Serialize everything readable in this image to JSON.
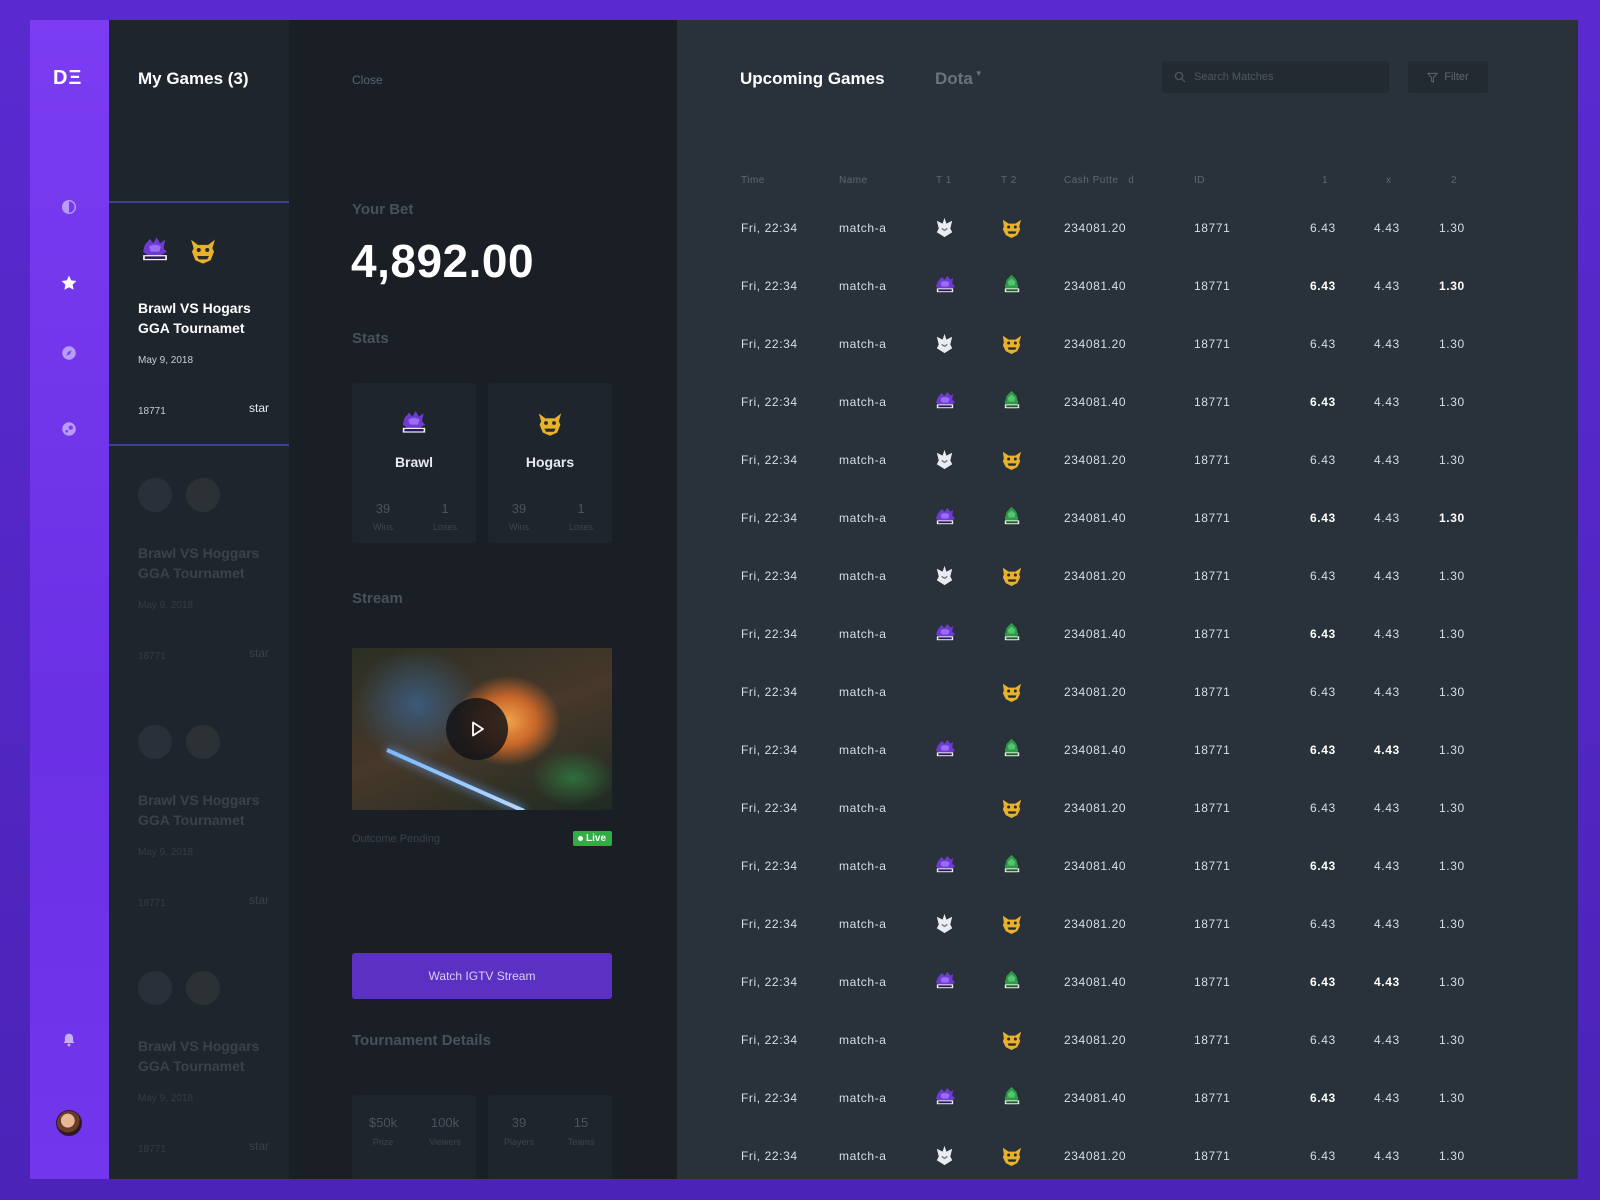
{
  "app": {
    "logo": "DΞ"
  },
  "nav": {
    "icons": [
      "half-circle-icon",
      "star-icon",
      "compass-icon",
      "steam-icon",
      "bell-icon"
    ]
  },
  "my_games": {
    "title": "My Games (3)",
    "active": {
      "team1_logo": "brawl-logo",
      "team2_logo": "hogars-logo",
      "title": "Brawl VS Hogars GGA Tournamet",
      "date": "May 9, 2018",
      "id": "18771",
      "star_label": "star"
    },
    "faded": [
      {
        "title": "Brawl VS Hoggars GGA Tournamet",
        "date": "May 9, 2018",
        "id": "18771",
        "star_label": "star"
      },
      {
        "title": "Brawl VS Hoggars GGA Tournamet",
        "date": "May 9, 2018",
        "id": "18771",
        "star_label": "star"
      },
      {
        "title": "Brawl VS Hoggars GGA Tournamet",
        "date": "May 9, 2018",
        "id": "18771",
        "star_label": "star"
      }
    ]
  },
  "detail": {
    "close_label": "Close",
    "bet_label": "Your Bet",
    "bet_amount": "4,892.00",
    "stats_label": "Stats",
    "teams": [
      {
        "name": "Brawl",
        "logo": "brawl-logo",
        "wins": "39",
        "wins_label": "Wins",
        "loses": "1",
        "loses_label": "Loses"
      },
      {
        "name": "Hogars",
        "logo": "hogars-logo",
        "wins": "39",
        "wins_label": "Wins",
        "loses": "1",
        "loses_label": "Loses"
      }
    ],
    "stream_label": "Stream",
    "outcome_label": "Outcome Pending",
    "live_label": "Live",
    "watch_button": "Watch IGTV Stream",
    "tournament_label": "Tournament Details",
    "tournament": [
      {
        "v1": "$50k",
        "l1": "Prize",
        "v2": "100k",
        "l2": "Viewers"
      },
      {
        "v1": "39",
        "l1": "Players",
        "v2": "15",
        "l2": "Teams"
      }
    ]
  },
  "upcoming": {
    "title": "Upcoming Games",
    "game_select": "Dota",
    "search_placeholder": "Search Matches",
    "filter_label": "Filter",
    "columns": [
      "Time",
      "Name",
      "T 1",
      "T 2",
      "Cash Putte   d",
      "ID",
      "1",
      "x",
      "2"
    ],
    "rows": [
      {
        "time": "Fri, 22:34",
        "name": "match-a",
        "t1": "wolf-logo",
        "t2": "hogars-logo",
        "cash": "234081.20",
        "id": "18771",
        "o1": "6.43",
        "ox": "4.43",
        "o2": "1.30",
        "b1": false,
        "bx": false,
        "b2": false
      },
      {
        "time": "Fri, 22:34",
        "name": "match-a",
        "t1": "brawl-logo",
        "t2": "ace-logo",
        "cash": "234081.40",
        "id": "18771",
        "o1": "6.43",
        "ox": "4.43",
        "o2": "1.30",
        "b1": true,
        "bx": false,
        "b2": true
      },
      {
        "time": "Fri, 22:34",
        "name": "match-a",
        "t1": "wolf-logo",
        "t2": "hogars-logo",
        "cash": "234081.20",
        "id": "18771",
        "o1": "6.43",
        "ox": "4.43",
        "o2": "1.30",
        "b1": false,
        "bx": false,
        "b2": false
      },
      {
        "time": "Fri, 22:34",
        "name": "match-a",
        "t1": "brawl-logo",
        "t2": "ace-logo",
        "cash": "234081.40",
        "id": "18771",
        "o1": "6.43",
        "ox": "4.43",
        "o2": "1.30",
        "b1": true,
        "bx": false,
        "b2": false
      },
      {
        "time": "Fri, 22:34",
        "name": "match-a",
        "t1": "wolf-logo",
        "t2": "hogars-logo",
        "cash": "234081.20",
        "id": "18771",
        "o1": "6.43",
        "ox": "4.43",
        "o2": "1.30",
        "b1": false,
        "bx": false,
        "b2": false
      },
      {
        "time": "Fri, 22:34",
        "name": "match-a",
        "t1": "brawl-logo",
        "t2": "ace-logo",
        "cash": "234081.40",
        "id": "18771",
        "o1": "6.43",
        "ox": "4.43",
        "o2": "1.30",
        "b1": true,
        "bx": false,
        "b2": true
      },
      {
        "time": "Fri, 22:34",
        "name": "match-a",
        "t1": "wolf-logo",
        "t2": "hogars-logo",
        "cash": "234081.20",
        "id": "18771",
        "o1": "6.43",
        "ox": "4.43",
        "o2": "1.30",
        "b1": false,
        "bx": false,
        "b2": false
      },
      {
        "time": "Fri, 22:34",
        "name": "match-a",
        "t1": "brawl-logo",
        "t2": "ace-logo",
        "cash": "234081.40",
        "id": "18771",
        "o1": "6.43",
        "ox": "4.43",
        "o2": "1.30",
        "b1": true,
        "bx": false,
        "b2": false
      },
      {
        "time": "Fri, 22:34",
        "name": "match-a",
        "t1": "",
        "t2": "hogars-logo",
        "cash": "234081.20",
        "id": "18771",
        "o1": "6.43",
        "ox": "4.43",
        "o2": "1.30",
        "b1": false,
        "bx": false,
        "b2": false
      },
      {
        "time": "Fri, 22:34",
        "name": "match-a",
        "t1": "brawl-logo",
        "t2": "ace-logo",
        "cash": "234081.40",
        "id": "18771",
        "o1": "6.43",
        "ox": "4.43",
        "o2": "1.30",
        "b1": true,
        "bx": true,
        "b2": false
      },
      {
        "time": "Fri, 22:34",
        "name": "match-a",
        "t1": "",
        "t2": "hogars-logo",
        "cash": "234081.20",
        "id": "18771",
        "o1": "6.43",
        "ox": "4.43",
        "o2": "1.30",
        "b1": false,
        "bx": false,
        "b2": false
      },
      {
        "time": "Fri, 22:34",
        "name": "match-a",
        "t1": "brawl-logo",
        "t2": "ace-logo",
        "cash": "234081.40",
        "id": "18771",
        "o1": "6.43",
        "ox": "4.43",
        "o2": "1.30",
        "b1": true,
        "bx": false,
        "b2": false
      },
      {
        "time": "Fri, 22:34",
        "name": "match-a",
        "t1": "wolf-logo",
        "t2": "hogars-logo",
        "cash": "234081.20",
        "id": "18771",
        "o1": "6.43",
        "ox": "4.43",
        "o2": "1.30",
        "b1": false,
        "bx": false,
        "b2": false
      },
      {
        "time": "Fri, 22:34",
        "name": "match-a",
        "t1": "brawl-logo",
        "t2": "ace-logo",
        "cash": "234081.40",
        "id": "18771",
        "o1": "6.43",
        "ox": "4.43",
        "o2": "1.30",
        "b1": true,
        "bx": true,
        "b2": false
      },
      {
        "time": "Fri, 22:34",
        "name": "match-a",
        "t1": "",
        "t2": "hogars-logo",
        "cash": "234081.20",
        "id": "18771",
        "o1": "6.43",
        "ox": "4.43",
        "o2": "1.30",
        "b1": false,
        "bx": false,
        "b2": false
      },
      {
        "time": "Fri, 22:34",
        "name": "match-a",
        "t1": "brawl-logo",
        "t2": "ace-logo",
        "cash": "234081.40",
        "id": "18771",
        "o1": "6.43",
        "ox": "4.43",
        "o2": "1.30",
        "b1": true,
        "bx": false,
        "b2": false
      },
      {
        "time": "Fri, 22:34",
        "name": "match-a",
        "t1": "wolf-logo",
        "t2": "hogars-logo",
        "cash": "234081.20",
        "id": "18771",
        "o1": "6.43",
        "ox": "4.43",
        "o2": "1.30",
        "b1": false,
        "bx": false,
        "b2": false
      }
    ]
  },
  "colors": {
    "accent": "#7b3cf2",
    "live": "#2fae44",
    "button": "#5b30c2"
  }
}
